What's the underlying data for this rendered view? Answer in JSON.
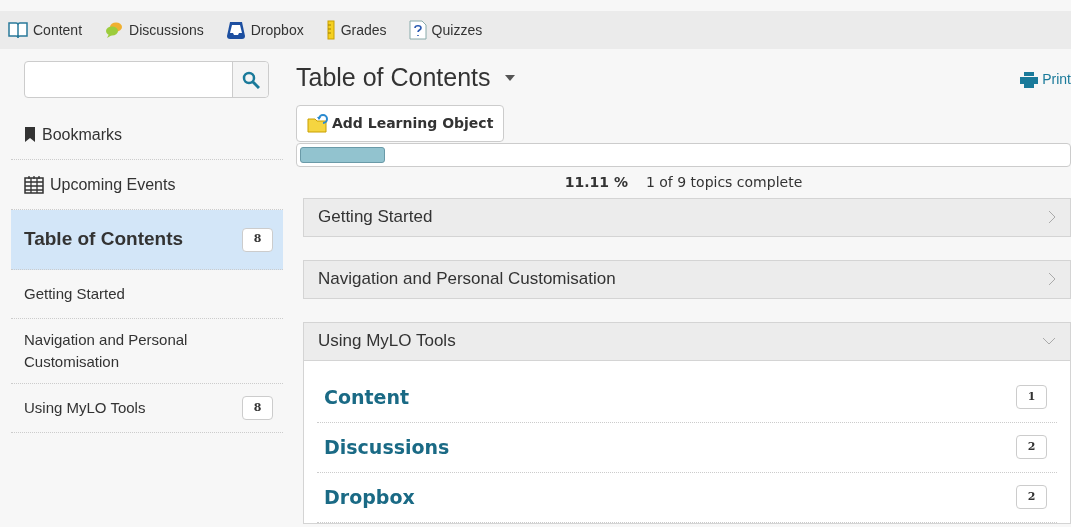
{
  "toolbar": [
    {
      "label": "Content",
      "kind": "book"
    },
    {
      "label": "Discussions",
      "kind": "bubbles"
    },
    {
      "label": "Dropbox",
      "kind": "tray"
    },
    {
      "label": "Grades",
      "kind": "ruler"
    },
    {
      "label": "Quizzes",
      "kind": "question"
    }
  ],
  "sidebar": {
    "items": [
      {
        "kind": "bookmark",
        "label": "Bookmarks",
        "selected": false
      },
      {
        "kind": "calendar",
        "label": "Upcoming Events",
        "selected": false
      },
      {
        "kind": "module",
        "label": "Table of Contents",
        "count": "8",
        "selected": true
      },
      {
        "kind": "module",
        "label": "Getting Started",
        "selected": false
      },
      {
        "kind": "module",
        "label": "Navigation and Personal Customisation",
        "selected": false
      },
      {
        "kind": "module",
        "label": "Using MyLO Tools",
        "count": "8",
        "selected": false
      }
    ]
  },
  "main": {
    "title": "Table of Contents",
    "print": "Print",
    "add_button": "Add Learning Object",
    "progress": {
      "level": 0.1111,
      "percent": "11.11 %",
      "summary": "1 of 9 topics complete"
    },
    "sections": [
      {
        "title": "Getting Started",
        "expanded": false
      },
      {
        "title": "Navigation and Personal Customisation",
        "expanded": false
      },
      {
        "title": "Using MyLO Tools",
        "expanded": true,
        "children": [
          {
            "title": "Content",
            "count": "1"
          },
          {
            "title": "Discussions",
            "count": "2"
          },
          {
            "title": "Dropbox",
            "count": "2"
          }
        ]
      }
    ]
  }
}
